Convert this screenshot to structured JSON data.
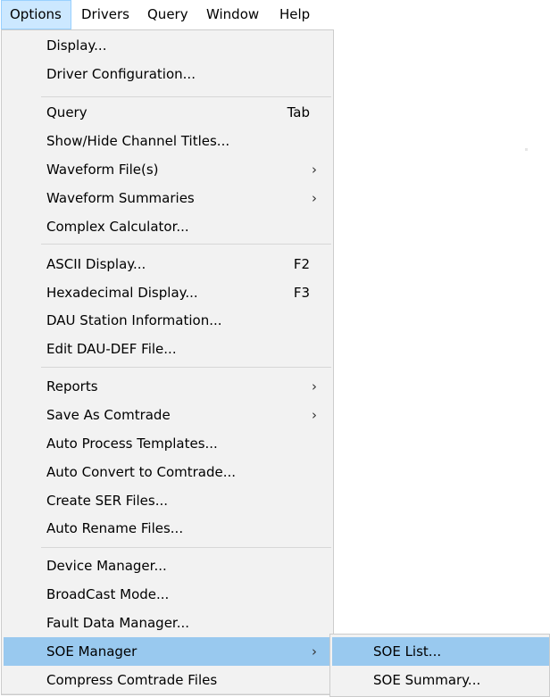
{
  "menubar": {
    "items": [
      {
        "label": "Options"
      },
      {
        "label": "Drivers"
      },
      {
        "label": "Query"
      },
      {
        "label": "Window"
      },
      {
        "label": "Help"
      }
    ]
  },
  "options_menu": {
    "items": [
      {
        "label": "Display...",
        "shortcut": "",
        "submenu": false
      },
      {
        "label": "Driver Configuration...",
        "shortcut": "",
        "submenu": false
      },
      {
        "label": "Query",
        "shortcut": "Tab",
        "submenu": false
      },
      {
        "label": "Show/Hide Channel Titles...",
        "shortcut": "",
        "submenu": false
      },
      {
        "label": "Waveform File(s)",
        "shortcut": "",
        "submenu": true
      },
      {
        "label": "Waveform Summaries",
        "shortcut": "",
        "submenu": true
      },
      {
        "label": "Complex Calculator...",
        "shortcut": "",
        "submenu": false
      },
      {
        "label": "ASCII Display...",
        "shortcut": "F2",
        "submenu": false
      },
      {
        "label": "Hexadecimal Display...",
        "shortcut": "F3",
        "submenu": false
      },
      {
        "label": "DAU Station Information...",
        "shortcut": "",
        "submenu": false
      },
      {
        "label": "Edit DAU-DEF File...",
        "shortcut": "",
        "submenu": false
      },
      {
        "label": "Reports",
        "shortcut": "",
        "submenu": true
      },
      {
        "label": "Save As Comtrade",
        "shortcut": "",
        "submenu": true
      },
      {
        "label": "Auto Process Templates...",
        "shortcut": "",
        "submenu": false
      },
      {
        "label": "Auto Convert to Comtrade...",
        "shortcut": "",
        "submenu": false
      },
      {
        "label": "Create SER Files...",
        "shortcut": "",
        "submenu": false
      },
      {
        "label": "Auto Rename Files...",
        "shortcut": "",
        "submenu": false
      },
      {
        "label": "Device Manager...",
        "shortcut": "",
        "submenu": false
      },
      {
        "label": "BroadCast Mode...",
        "shortcut": "",
        "submenu": false
      },
      {
        "label": "Fault Data Manager...",
        "shortcut": "",
        "submenu": false
      },
      {
        "label": "SOE Manager",
        "shortcut": "",
        "submenu": true
      },
      {
        "label": "Compress Comtrade Files",
        "shortcut": "",
        "submenu": false
      }
    ],
    "submenu_arrow": "›"
  },
  "soe_submenu": {
    "items": [
      {
        "label": "SOE List..."
      },
      {
        "label": "SOE Summary..."
      }
    ]
  },
  "colors": {
    "menu_background": "#f2f2f2",
    "highlight": "#99c9ef",
    "menubar_active": "#cce8ff",
    "separator": "#d7d7d7"
  }
}
